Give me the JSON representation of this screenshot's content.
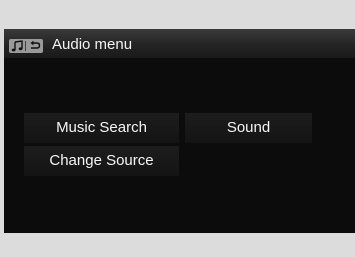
{
  "screen": {
    "title": "Audio menu",
    "title_icons": [
      "music-note-icon",
      "back-arrow-icon"
    ]
  },
  "menu": {
    "music_search": "Music Search",
    "sound": "Sound",
    "change_source": "Change Source"
  },
  "colors": {
    "background": "#dcdcdc",
    "screen": "#0c0c0c",
    "text": "#f4f4f4",
    "icon_badge": "#9a9a9a"
  }
}
